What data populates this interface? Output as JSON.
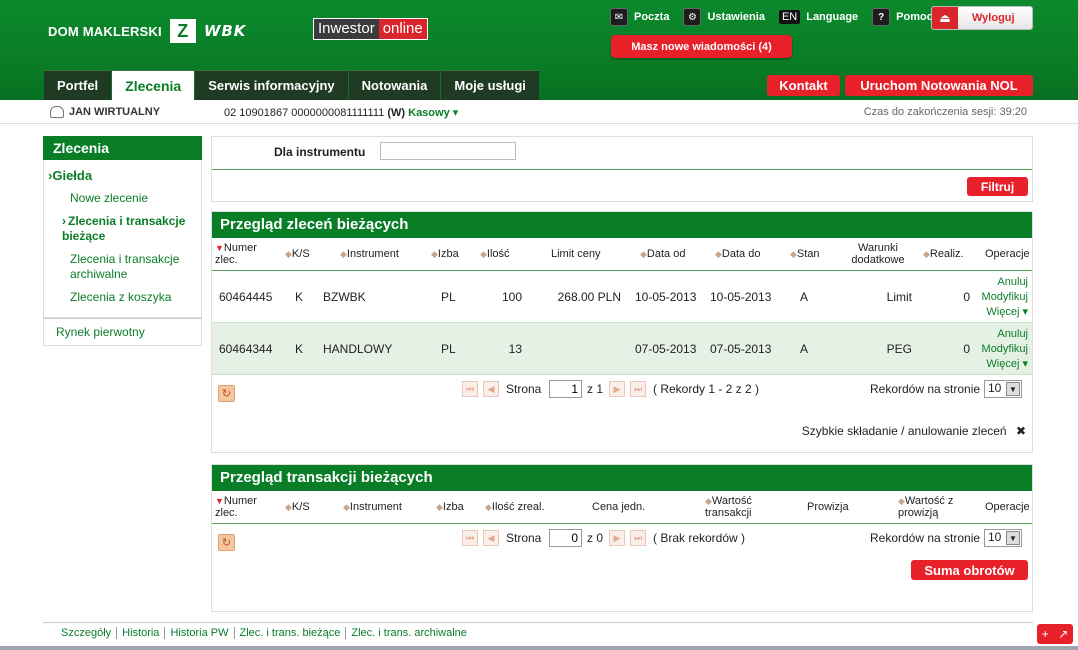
{
  "header": {
    "brand_left": "DOM MAKLERSKI",
    "brand_logo": "Z",
    "brand_right": "WBK",
    "inwestor_a": "Inwestor",
    "inwestor_b": "online",
    "links": [
      {
        "label": "Poczta",
        "icon": "mail-icon"
      },
      {
        "label": "Ustawienia",
        "icon": "gear-icon"
      },
      {
        "label": "Language",
        "icon": "EN"
      },
      {
        "label": "Pomoc",
        "icon": "help-icon"
      }
    ],
    "logout": "Wyloguj",
    "new_messages": "Masz nowe wiadomości (4)",
    "kontakt": "Kontakt",
    "nol": "Uruchom Notowania NOL"
  },
  "tabs": [
    "Portfel",
    "Zlecenia",
    "Serwis informacyjny",
    "Notowania",
    "Moje usługi"
  ],
  "active_tab": "Zlecenia",
  "userbar": {
    "user": "JAN WIRTUALNY",
    "account": "02 10901867 0000000081111111",
    "account_type_code": "(W)",
    "account_type": "Kasowy",
    "session": "Czas do zakończenia sesji: 39:20"
  },
  "sidebar": {
    "title": "Zlecenia",
    "group": "Giełda",
    "items": [
      "Nowe zlecenie",
      "Zlecenia i transakcje bieżące",
      "Zlecenia i transakcje archiwalne",
      "Zlecenia z koszyka"
    ],
    "rynek": "Rynek pierwotny"
  },
  "filter": {
    "label": "Dla instrumentu",
    "value": "",
    "button": "Filtruj"
  },
  "orders": {
    "title": "Przegląd zleceń bieżących",
    "headers": [
      "Numer zlec.",
      "K/S",
      "Instrument",
      "Izba",
      "Ilość",
      "Limit ceny",
      "Data od",
      "Data do",
      "Stan",
      "Warunki dodatkowe",
      "Realiz.",
      "Operacje"
    ],
    "rows": [
      {
        "num": "60464445",
        "ks": "K",
        "instrument": "BZWBK",
        "izba": "PL",
        "ilosc": "100",
        "limit": "268.00 PLN",
        "data_od": "10-05-2013",
        "data_do": "10-05-2013",
        "stan": "A",
        "warunki": "Limit",
        "realiz": "0"
      },
      {
        "num": "60464344",
        "ks": "K",
        "instrument": "HANDLOWY",
        "izba": "PL",
        "ilosc": "13",
        "limit": "",
        "data_od": "07-05-2013",
        "data_do": "07-05-2013",
        "stan": "A",
        "warunki": "PEG",
        "realiz": "0"
      }
    ],
    "ops": [
      "Anuluj",
      "Modyfikuj",
      "Więcej ▾"
    ],
    "pager": {
      "strona": "Strona",
      "page": "1",
      "of": "z 1",
      "records": "( Rekordy 1 - 2 z 2 )",
      "per_page_label": "Rekordów na stronie",
      "per_page": "10"
    },
    "quick": "Szybkie składanie / anulowanie zleceń"
  },
  "transactions": {
    "title": "Przegląd transakcji bieżących",
    "headers": [
      "Numer zlec.",
      "K/S",
      "Instrument",
      "Izba",
      "Ilość zreal.",
      "Cena jedn.",
      "Wartość transakcji",
      "Prowizja",
      "Wartość z prowizją",
      "Operacje"
    ],
    "pager": {
      "strona": "Strona",
      "page": "0",
      "of": "z 0",
      "records": "( Brak rekordów )",
      "per_page_label": "Rekordów na stronie",
      "per_page": "10"
    },
    "sum_button": "Suma obrotów"
  },
  "footer": [
    "Szczegóły",
    "Historia",
    "Historia PW",
    "Zlec. i trans. bieżące",
    "Zlec. i trans. archiwalne"
  ]
}
